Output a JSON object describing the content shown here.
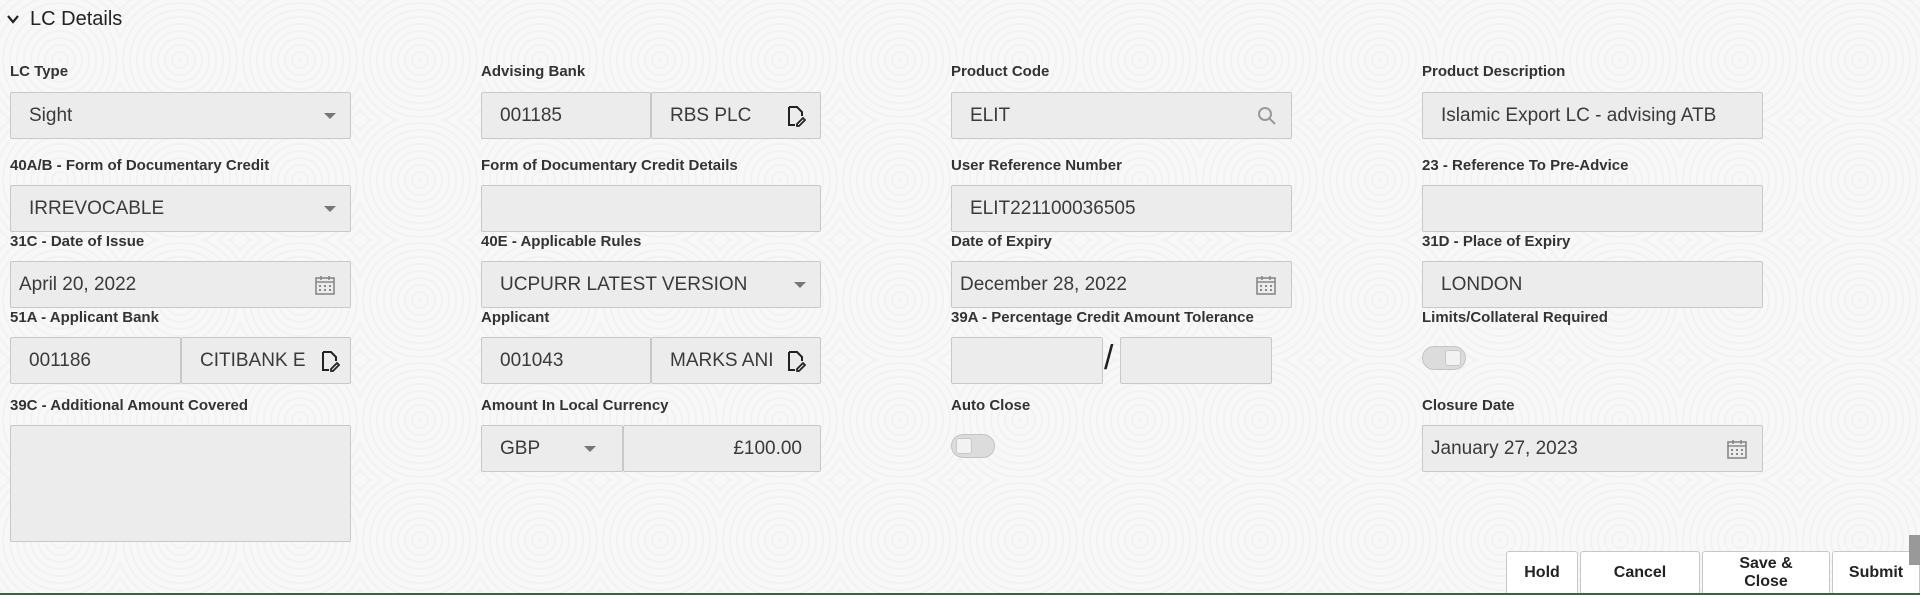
{
  "section": {
    "title": "LC Details"
  },
  "fields": {
    "lc_type": {
      "label": "LC Type",
      "value": "Sight"
    },
    "advising_bank": {
      "label": "Advising Bank",
      "code": "001185",
      "name": "RBS PLC"
    },
    "product_code": {
      "label": "Product Code",
      "value": "ELIT"
    },
    "product_description": {
      "label": "Product Description",
      "value": "Islamic Export LC - advising ATB"
    },
    "form_of_credit": {
      "label": "40A/B - Form of Documentary Credit",
      "value": "IRREVOCABLE"
    },
    "form_of_credit_details": {
      "label": "Form of Documentary Credit Details",
      "value": ""
    },
    "user_reference": {
      "label": "User Reference Number",
      "value": "ELIT221100036505"
    },
    "pre_advice_reference": {
      "label": "23 - Reference To Pre-Advice",
      "value": ""
    },
    "date_of_issue": {
      "label": "31C - Date of Issue",
      "value": "April 20, 2022"
    },
    "applicable_rules": {
      "label": "40E - Applicable Rules",
      "value": "UCPURR LATEST VERSION"
    },
    "date_of_expiry": {
      "label": "Date of Expiry",
      "value": "December 28, 2022"
    },
    "place_of_expiry": {
      "label": "31D - Place of Expiry",
      "value": "LONDON"
    },
    "applicant_bank": {
      "label": "51A - Applicant Bank",
      "code": "001186",
      "name": "CITIBANK E"
    },
    "applicant": {
      "label": "Applicant",
      "code": "001043",
      "name": "MARKS ANI"
    },
    "tolerance": {
      "label": "39A - Percentage Credit Amount Tolerance",
      "separator": "/",
      "plus": "",
      "minus": ""
    },
    "limits_required": {
      "label": "Limits/Collateral Required",
      "on": true
    },
    "additional_amount": {
      "label": "39C - Additional Amount Covered",
      "value": ""
    },
    "local_amount": {
      "label": "Amount In Local Currency",
      "currency": "GBP",
      "amount": "£100.00"
    },
    "auto_close": {
      "label": "Auto Close",
      "on": false
    },
    "closure_date": {
      "label": "Closure Date",
      "value": "January 27, 2023"
    }
  },
  "buttons": {
    "hold": "Hold",
    "cancel": "Cancel",
    "save_close": "Save & Close",
    "submit": "Submit"
  }
}
